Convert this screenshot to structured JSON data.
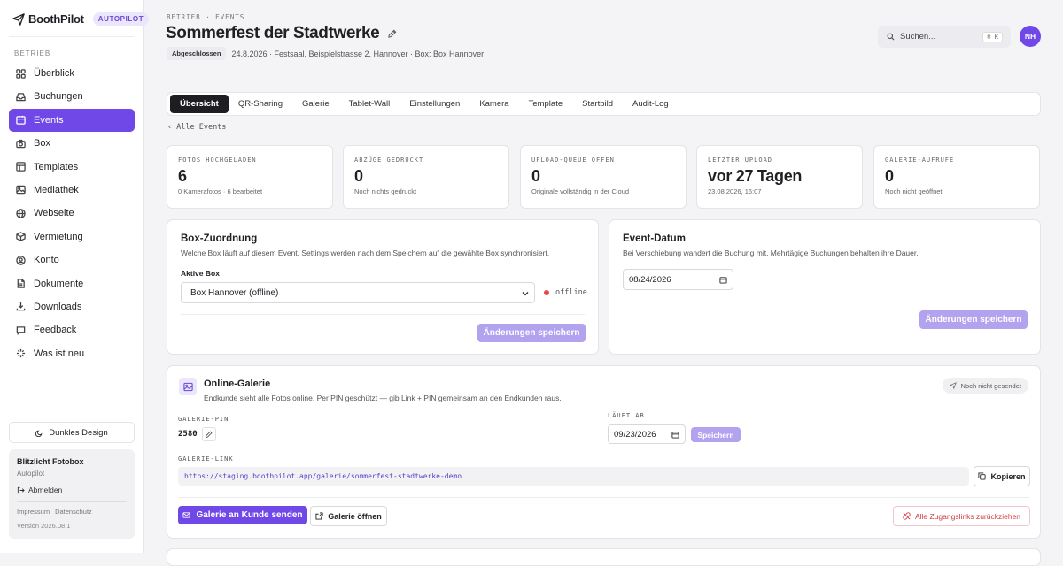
{
  "brand": {
    "name": "BoothPilot",
    "badge": "AUTOPILOT"
  },
  "sidebar": {
    "section_label": "BETRIEB",
    "items": [
      {
        "label": "Überblick",
        "icon": "grid-icon"
      },
      {
        "label": "Buchungen",
        "icon": "inbox-icon"
      },
      {
        "label": "Events",
        "icon": "calendar-icon"
      },
      {
        "label": "Box",
        "icon": "camera-icon"
      },
      {
        "label": "Templates",
        "icon": "layers-icon"
      },
      {
        "label": "Mediathek",
        "icon": "image-icon"
      },
      {
        "label": "Webseite",
        "icon": "globe-icon"
      },
      {
        "label": "Vermietung",
        "icon": "package-icon"
      },
      {
        "label": "Konto",
        "icon": "user-circle-icon"
      },
      {
        "label": "Dokumente",
        "icon": "file-icon"
      },
      {
        "label": "Downloads",
        "icon": "download-icon"
      },
      {
        "label": "Feedback",
        "icon": "message-icon"
      },
      {
        "label": "Was ist neu",
        "icon": "sparkle-icon"
      }
    ],
    "active_index": 2,
    "dark_mode_label": "Dunkles Design",
    "account": {
      "name": "Blitzlicht Fotobox",
      "plan": "Autopilot",
      "logout_label": "Abmelden",
      "imprint_label": "Impressum",
      "privacy_label": "Datenschutz",
      "version": "Version 2026.08.1"
    }
  },
  "header": {
    "breadcrumb": "BETRIEB · EVENTS",
    "title": "Sommerfest der Stadtwerke",
    "status_badge": "Abgeschlossen",
    "meta": "24.8.2026 · Festsaal, Beispielstrasse 2, Hannover · Box: Box Hannover",
    "search_placeholder": "Suchen...",
    "search_shortcut": "⌘ K",
    "avatar_initials": "NH"
  },
  "tabs": {
    "items": [
      "Übersicht",
      "QR-Sharing",
      "Galerie",
      "Tablet-Wall",
      "Einstellungen",
      "Kamera",
      "Template",
      "Startbild",
      "Audit-Log"
    ],
    "active_index": 0
  },
  "back_link": "Alle Events",
  "stats": [
    {
      "label": "FOTOS HOCHGELADEN",
      "value": "6",
      "sub": "0 Kamerafotos · 6 bearbeitet"
    },
    {
      "label": "ABZÜGE GEDRUCKT",
      "value": "0",
      "sub": "Noch nichts gedruckt"
    },
    {
      "label": "UPLOAD-QUEUE OFFEN",
      "value": "0",
      "sub": "Originale vollständig in der Cloud"
    },
    {
      "label": "LETZTER UPLOAD",
      "value": "vor 27 Tagen",
      "sub": "23.08.2026, 16:07"
    },
    {
      "label": "GALERIE-AUFRUFE",
      "value": "0",
      "sub": "Noch nicht geöffnet"
    }
  ],
  "box_card": {
    "title": "Box-Zuordnung",
    "description": "Welche Box läuft auf diesem Event. Settings werden nach dem Speichern auf die gewählte Box synchronisiert.",
    "field_label": "Aktive Box",
    "selected_box": "Box Hannover (offline)",
    "status_text": "offline",
    "save_label": "Änderungen speichern",
    "status_color": "#e5484d"
  },
  "date_card": {
    "title": "Event-Datum",
    "description": "Bei Verschiebung wandert die Buchung mit. Mehrtägige Buchungen behalten ihre Dauer.",
    "date_value": "08/24/2026",
    "save_label": "Änderungen speichern"
  },
  "gallery_card": {
    "title": "Online-Galerie",
    "description": "Endkunde sieht alle Fotos online. Per PIN geschützt — gib Link + PIN gemeinsam an den Endkunden raus.",
    "status_pill": "Noch nicht gesendet",
    "pin_label": "GALERIE-PIN",
    "pin_value": "2580",
    "expires_label": "LÄUFT AB",
    "expires_value": "09/23/2026",
    "save_label": "Speichern",
    "link_label": "GALERIE-LINK",
    "link_value": "https://staging.boothpilot.app/galerie/sommerfest-stadtwerke-demo",
    "copy_label": "Kopieren",
    "send_label": "Galerie an Kunde senden",
    "open_label": "Galerie öffnen",
    "revoke_label": "Alle Zugangslinks zurückziehen"
  },
  "colors": {
    "accent": "#7048e8",
    "accent_light": "#b3a3ef",
    "danger": "#d13b40"
  }
}
